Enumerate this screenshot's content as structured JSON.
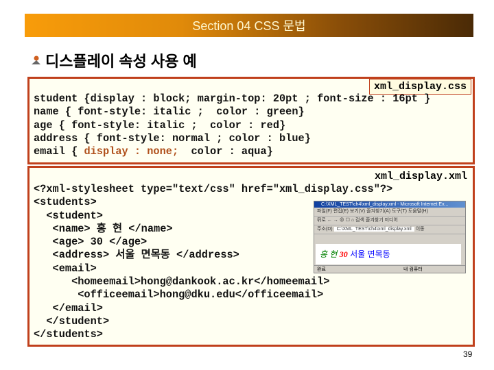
{
  "header": {
    "title": "Section 04 CSS 문법"
  },
  "heading": {
    "text": "디스플레이 속성 사용 예",
    "icon": "person-bullet-icon"
  },
  "css_box": {
    "filename": "xml_display.css",
    "lines": [
      "student {display : block; margin-top: 20pt ; font-size : 16pt }",
      "name { font-style: italic ;  color : green}",
      "age { font-style: italic ;  color : red}",
      "address { font-style: normal ; color : blue}"
    ],
    "email_line": {
      "pre": "email { ",
      "highlight": "display : none;",
      "post": "  color : aqua}"
    }
  },
  "xml_box": {
    "filename": "xml_display.xml",
    "lines": [
      "<?xml-stylesheet type=\"text/css\" href=\"xml_display.css\"?>",
      "<students>",
      "  <student>",
      "   <name> 홍 현 </name>",
      "   <age> 30 </age>",
      "   <address> 서울 면목동 </address>",
      "   <email>",
      "      <homeemail>hong@dankook.ac.kr</homeemail>",
      "       <officeemail>hong@dku.edu</officeemail>",
      "   </email>",
      "  </student>",
      "</students>"
    ]
  },
  "browser": {
    "title": "C:\\XML_TEST\\ch4\\xml_display.xml - Microsoft Internet Ex...",
    "menu": "파일(F)  편집(E)  보기(V)  즐겨찾기(A)  도구(T)  도움말(H)",
    "toolbar": "뒤로 ← → ⊗ ☐ ⌂  검색  즐겨찾기  미디어",
    "address_label": "주소(D)",
    "address": "C:\\XML_TEST\\ch4\\xml_display.xml",
    "go": "이동",
    "name": "홍 현",
    "age": "30",
    "address_text": "서울 면목동",
    "status_left": "완료",
    "status_right": "내 컴퓨터"
  },
  "page_number": "39"
}
